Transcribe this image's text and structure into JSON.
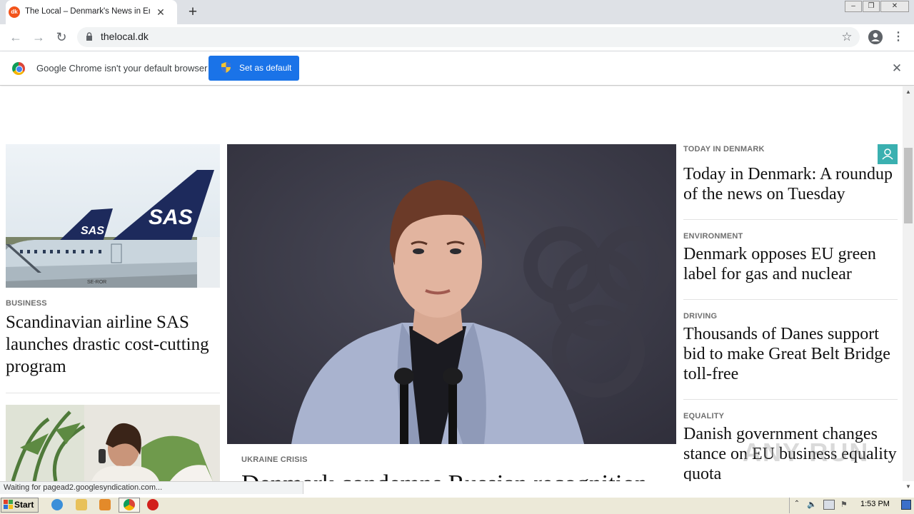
{
  "browser": {
    "tab": {
      "title": "The Local – Denmark's News in English",
      "favicon_text": "dk",
      "favicon_color": "#f2541b"
    },
    "url": "thelocal.dk",
    "infobar": {
      "message": "Google Chrome isn't your default browser",
      "button_label": "Set as default"
    }
  },
  "page": {
    "left_column": [
      {
        "kicker": "BUSINESS",
        "headline": "Scandinavian airline SAS launches drastic cost-cutting program",
        "image_text": "SAS",
        "registration": "SE-ROR"
      }
    ],
    "center": {
      "kicker": "UKRAINE CRISIS",
      "headline": "Denmark condemns Russian recognition"
    },
    "right_column": [
      {
        "kicker": "TODAY IN DENMARK",
        "headline": "Today in Denmark: A roundup of the news on Tuesday"
      },
      {
        "kicker": "ENVIRONMENT",
        "headline": "Denmark opposes EU green label for gas and nuclear"
      },
      {
        "kicker": "DRIVING",
        "headline": "Thousands of Danes support bid to make Great Belt Bridge toll-free"
      },
      {
        "kicker": "EQUALITY",
        "headline": "Danish government changes stance on EU business equality quota"
      }
    ],
    "account_button_color": "#3ab0b0"
  },
  "status": {
    "text": "Waiting for pagead2.googlesyndication.com..."
  },
  "taskbar": {
    "start_label": "Start",
    "clock": "1:53 PM"
  },
  "watermark": "ANY RUN",
  "colors": {
    "accent_blue": "#1a73e8",
    "teal": "#3ab0b0"
  }
}
